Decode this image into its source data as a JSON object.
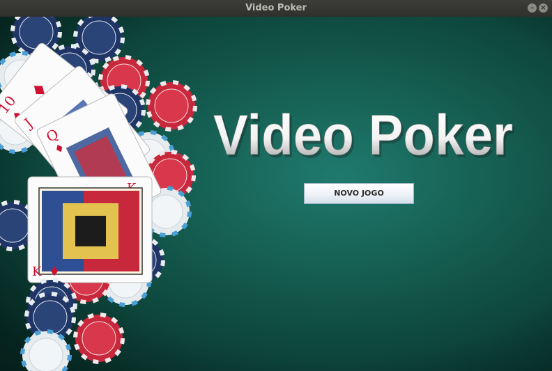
{
  "window": {
    "title": "Video Poker",
    "minimize_glyph": "–",
    "close_glyph": "×"
  },
  "main": {
    "heading": "Video Poker",
    "new_game_label": "NOVO JOGO"
  },
  "colors": {
    "felt": "#176658",
    "chip_navy": "#1f3566",
    "chip_red": "#c8283c",
    "chip_white": "#e8ecef",
    "card_red": "#d01030"
  },
  "cards": [
    {
      "rank": "10",
      "suit": "♦"
    },
    {
      "rank": "J",
      "suit": "♦"
    },
    {
      "rank": "Q",
      "suit": "♦"
    },
    {
      "rank": "K",
      "suit": "♦"
    }
  ]
}
